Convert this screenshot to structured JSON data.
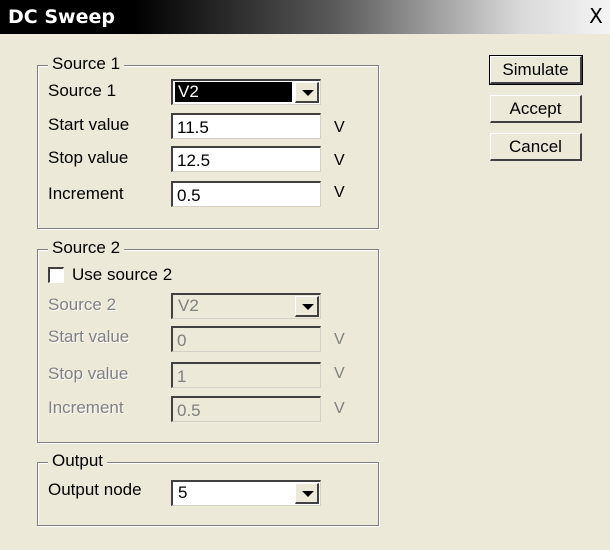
{
  "window": {
    "title": "DC Sweep",
    "close_label": "X"
  },
  "source1": {
    "legend": "Source 1",
    "source_label": "Source 1",
    "source_value": "V2",
    "start_label": "Start value",
    "start_value": "11.5",
    "stop_label": "Stop value",
    "stop_value": "12.5",
    "increment_label": "Increment",
    "increment_value": "0.5",
    "unit": "V"
  },
  "source2": {
    "legend": "Source 2",
    "use_label": "Use source 2",
    "use_checked": false,
    "source_label": "Source 2",
    "source_value": "V2",
    "start_label": "Start value",
    "start_value": "0",
    "stop_label": "Stop value",
    "stop_value": "1",
    "increment_label": "Increment",
    "increment_value": "0.5",
    "unit": "V"
  },
  "output": {
    "legend": "Output",
    "node_label": "Output node",
    "node_value": "5"
  },
  "buttons": {
    "simulate": "Simulate",
    "accept": "Accept",
    "cancel": "Cancel"
  }
}
